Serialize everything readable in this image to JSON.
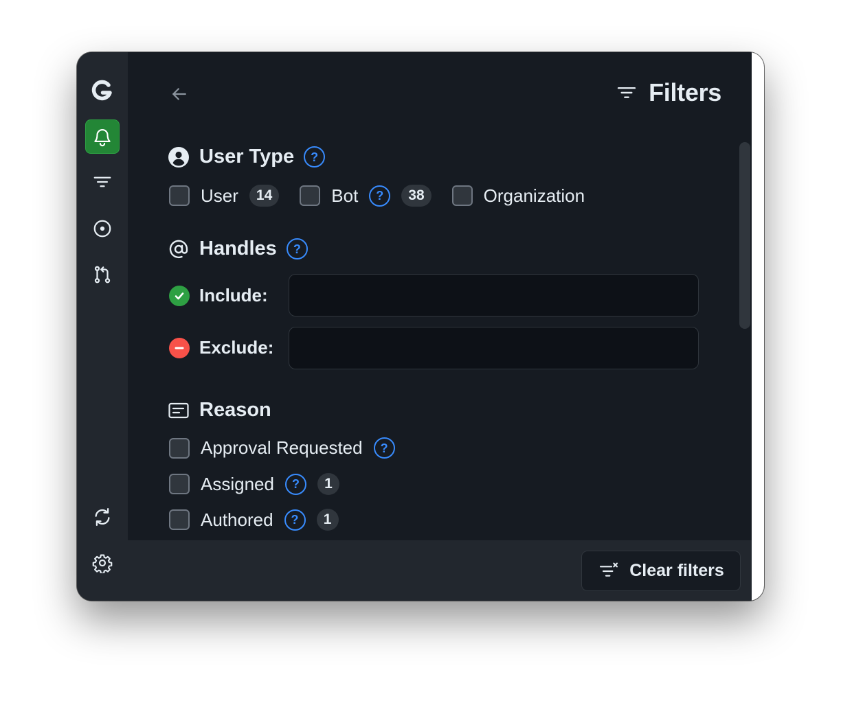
{
  "header": {
    "title": "Filters",
    "back_icon": "arrow-left-icon",
    "filter_icon": "filter-icon"
  },
  "sidebar": {
    "items": [
      {
        "name": "gitify-logo",
        "icon": "logo-g",
        "active": false
      },
      {
        "name": "notifications",
        "icon": "bell-icon",
        "active": true
      },
      {
        "name": "filters",
        "icon": "filter-icon",
        "active": false
      },
      {
        "name": "issues",
        "icon": "issue-opened-icon",
        "active": false
      },
      {
        "name": "pull-requests",
        "icon": "git-pull-request-icon",
        "active": false
      }
    ],
    "bottom_items": [
      {
        "name": "refresh",
        "icon": "sync-icon"
      },
      {
        "name": "settings",
        "icon": "gear-icon"
      }
    ]
  },
  "user_type": {
    "title": "User Type",
    "options": [
      {
        "label": "User",
        "count": "14",
        "checked": false,
        "has_help": false
      },
      {
        "label": "Bot",
        "count": "38",
        "checked": false,
        "has_help": true
      },
      {
        "label": "Organization",
        "count": "",
        "checked": false,
        "has_help": false
      }
    ]
  },
  "handles": {
    "title": "Handles",
    "include_label": "Include:",
    "include_value": "",
    "exclude_label": "Exclude:",
    "exclude_value": ""
  },
  "reason": {
    "title": "Reason",
    "options": [
      {
        "label": "Approval Requested",
        "count": "",
        "checked": false
      },
      {
        "label": "Assigned",
        "count": "1",
        "checked": false
      },
      {
        "label": "Authored",
        "count": "1",
        "checked": false
      }
    ]
  },
  "help_glyph": "?",
  "footer": {
    "clear_label": "Clear filters"
  },
  "colors": {
    "accent_green": "#238636",
    "help_blue": "#388bfd",
    "include_green": "#2ea043",
    "exclude_red": "#f85149",
    "background": "#161b22"
  }
}
